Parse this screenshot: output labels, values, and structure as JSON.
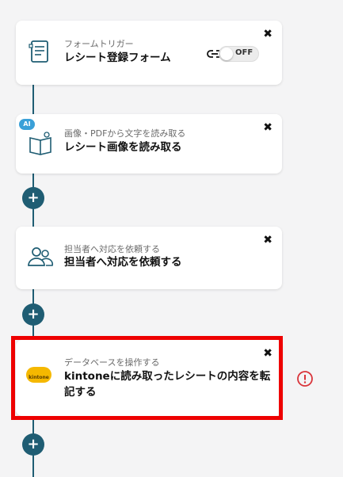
{
  "steps": [
    {
      "category": "フォームトリガー",
      "title": "レシート登録フォーム",
      "toggle_label": "OFF"
    },
    {
      "category": "画像・PDFから文字を読み取る",
      "title": "レシート画像を読み取る",
      "badge": "AI"
    },
    {
      "category": "担当者へ対応を依頼する",
      "title": "担当者へ対応を依頼する"
    },
    {
      "category": "データベースを操作する",
      "title": "kintoneに読み取ったレシートの内容を転記する",
      "logo_text": "kintone"
    }
  ],
  "close_glyph": "✖",
  "plus_glyph": "+",
  "colors": {
    "accent": "#1f5d73",
    "highlight": "#ee0000",
    "alert": "#d9343a",
    "ai_badge": "#3aa0d8",
    "kintone": "#f5b800"
  },
  "icons": [
    "form-icon",
    "link-icon",
    "ocr-book-icon",
    "users-icon",
    "kintone-logo-icon",
    "alert-icon",
    "close-icon",
    "plus-icon"
  ]
}
